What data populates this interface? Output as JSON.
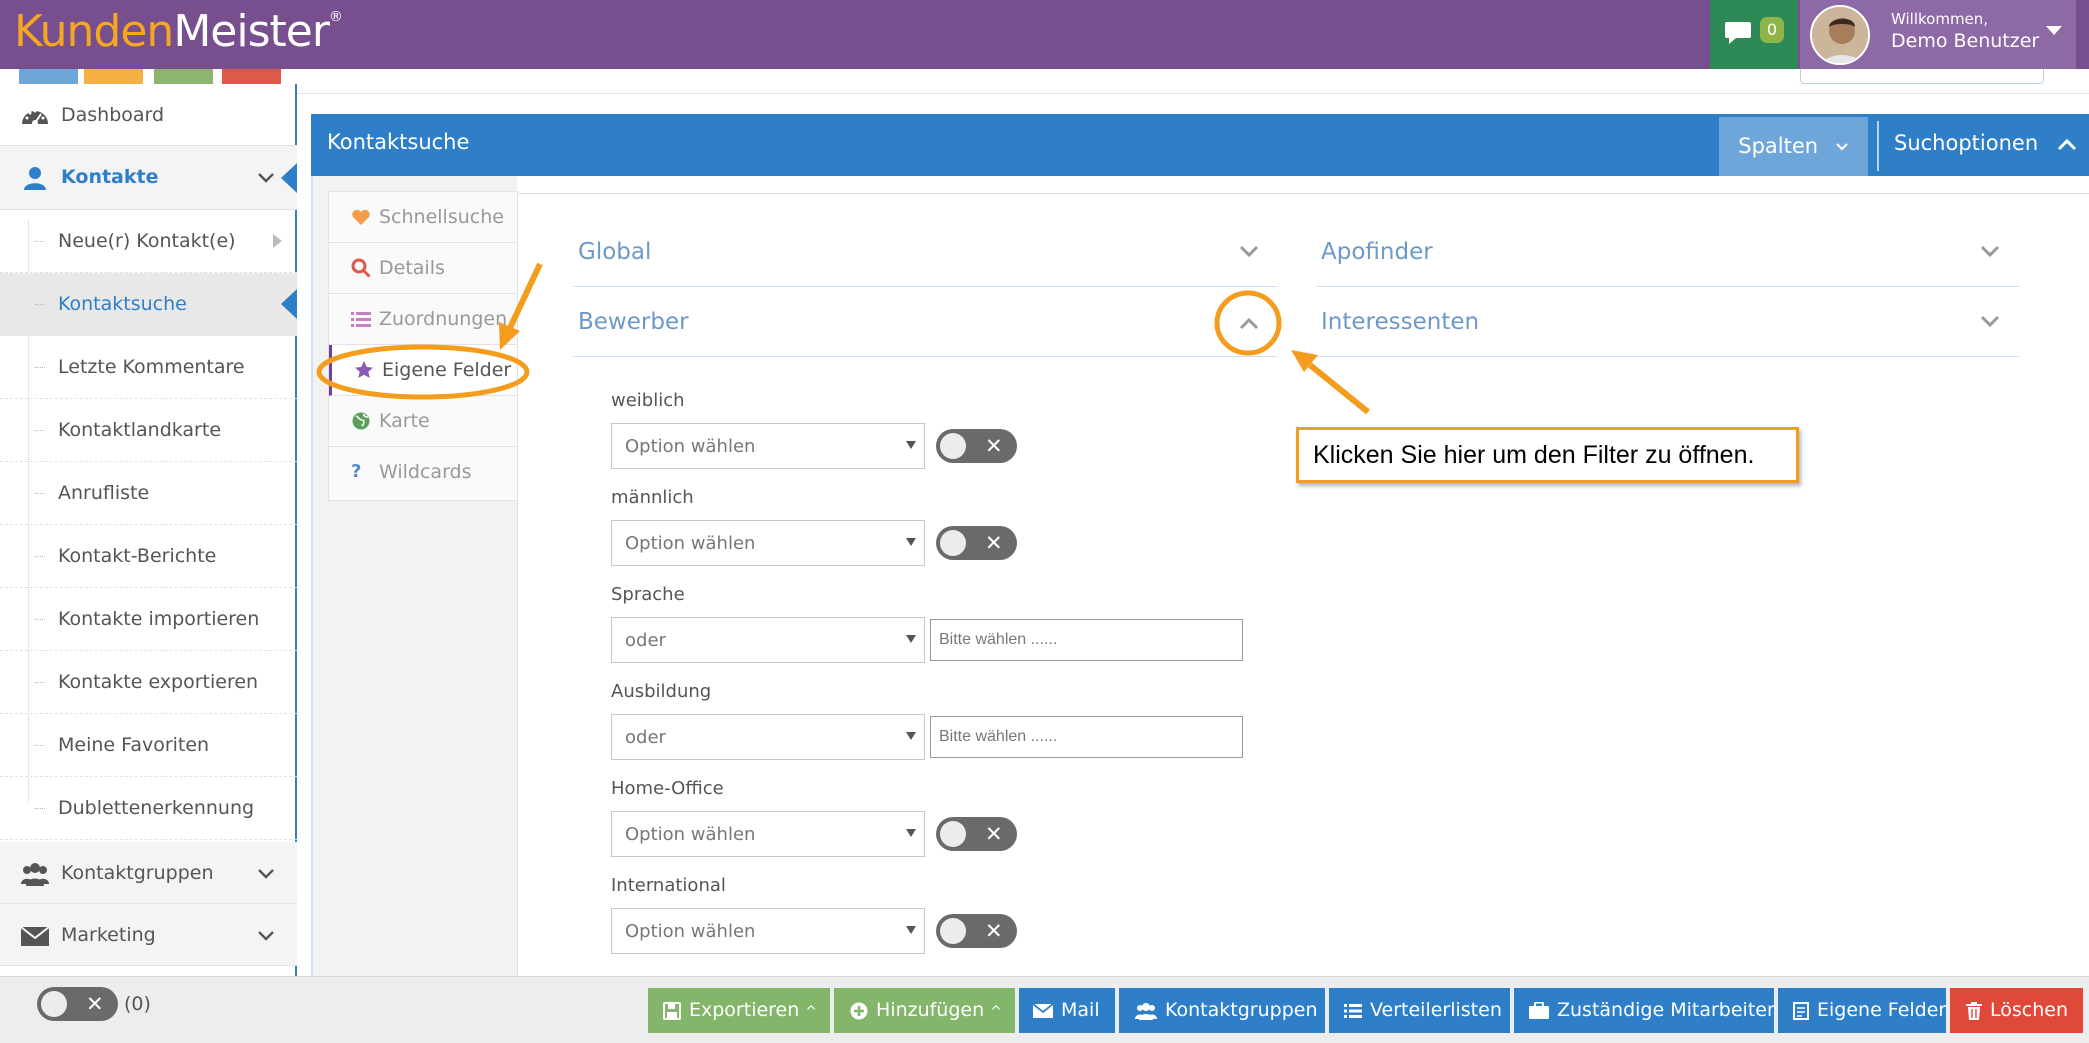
{
  "app": {
    "logo_part1": "Kunden",
    "logo_part2": "Meister",
    "logo_reg": "®",
    "chat_count": "0",
    "welcome": "Willkommen,",
    "username": "Demo Benutzer",
    "colors": {
      "topbar": "#774f8f",
      "primary": "#2f7fc8",
      "accent": "#f39c1e"
    },
    "color_tabs": [
      "#6fa6d9",
      "#f5b044",
      "#8db56e",
      "#dc5a4a"
    ]
  },
  "sidebar": {
    "items": [
      {
        "label": "Dashboard",
        "icon": "dashboard-icon"
      },
      {
        "label": "Kontakte",
        "icon": "user-icon",
        "expanded": true
      },
      {
        "label": "Kontaktgruppen",
        "icon": "users-icon"
      },
      {
        "label": "Marketing",
        "icon": "envelope-icon"
      }
    ],
    "subitems": [
      "Neue(r) Kontakt(e)",
      "Kontaktsuche",
      "Letzte Kommentare",
      "Kontaktlandkarte",
      "Anrufliste",
      "Kontakt-Berichte",
      "Kontakte importieren",
      "Kontakte exportieren",
      "Meine Favoriten",
      "Dublettenerkennung"
    ],
    "active_subitem": "Kontaktsuche"
  },
  "panel": {
    "title": "Kontaktsuche",
    "spalten_label": "Spalten",
    "suchoptionen_label": "Suchoptionen"
  },
  "tabs": [
    {
      "label": "Schnellsuche",
      "icon": "heart-icon",
      "color": "#f39c4a"
    },
    {
      "label": "Details",
      "icon": "search-icon",
      "color": "#dc5a4a"
    },
    {
      "label": "Zuordnungen",
      "icon": "list-icon",
      "color": "#c77fc6"
    },
    {
      "label": "Eigene Felder",
      "icon": "star-icon",
      "color": "#8a5ab4",
      "active": true
    },
    {
      "label": "Karte",
      "icon": "globe-icon",
      "color": "#5aa05a"
    },
    {
      "label": "Wildcards",
      "icon": "question-icon",
      "color": "#5a8bc8"
    }
  ],
  "sections": {
    "global": "Global",
    "apofinder": "Apofinder",
    "bewerber": "Bewerber",
    "interessenten": "Interessenten"
  },
  "fields": [
    {
      "label": "weiblich",
      "select": "Option wählen",
      "type": "toggle"
    },
    {
      "label": "männlich",
      "select": "Option wählen",
      "type": "toggle"
    },
    {
      "label": "Sprache",
      "select": "oder",
      "type": "input",
      "input_placeholder": "Bitte wählen ......"
    },
    {
      "label": "Ausbildung",
      "select": "oder",
      "type": "input",
      "input_placeholder": "Bitte wählen ......"
    },
    {
      "label": "Home-Office",
      "select": "Option wählen",
      "type": "toggle"
    },
    {
      "label": "International",
      "select": "Option wählen",
      "type": "toggle"
    }
  ],
  "callout": "Klicken Sie hier um den Filter zu öffnen.",
  "bottombar": {
    "count": "(0)",
    "buttons": [
      {
        "label": "Exportieren",
        "icon": "save-icon",
        "color": "#83b56a",
        "caret": "^"
      },
      {
        "label": "Hinzufügen",
        "icon": "plus-circle-icon",
        "color": "#83b56a",
        "caret": "^"
      },
      {
        "label": "Mail",
        "icon": "envelope-icon",
        "color": "#2f7fc8"
      },
      {
        "label": "Kontaktgruppen",
        "icon": "users-icon",
        "color": "#2f7fc8"
      },
      {
        "label": "Verteilerlisten",
        "icon": "list-icon",
        "color": "#2f7fc8"
      },
      {
        "label": "Zuständige Mitarbeiter",
        "icon": "briefcase-icon",
        "color": "#2f7fc8"
      },
      {
        "label": "Eigene Felder",
        "icon": "form-icon",
        "color": "#2f7fc8"
      },
      {
        "label": "Löschen",
        "icon": "trash-icon",
        "color": "#e0483a"
      }
    ]
  }
}
